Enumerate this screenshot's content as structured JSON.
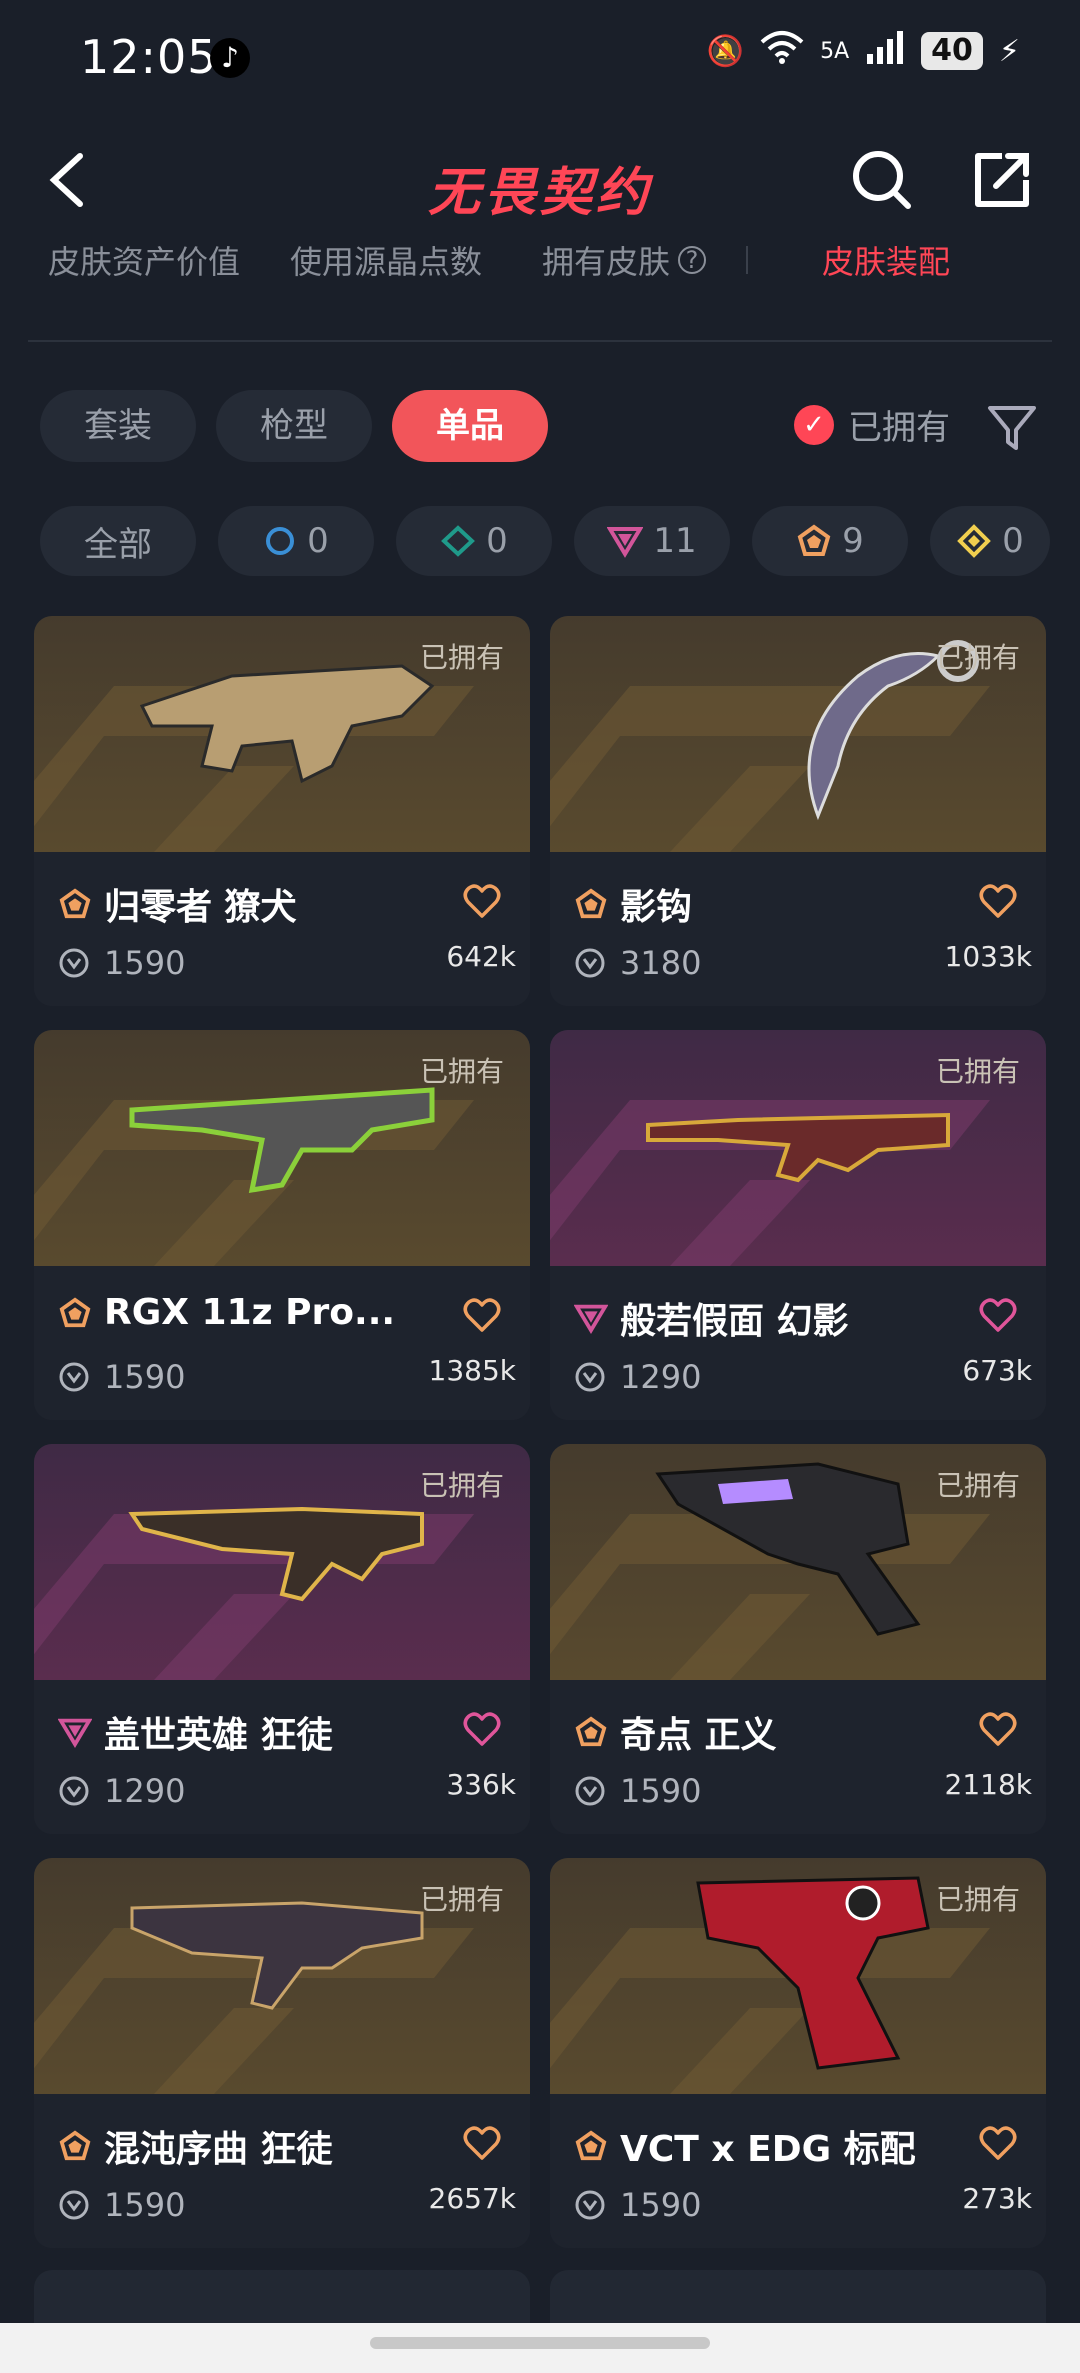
{
  "status": {
    "time": "12:05",
    "network": "5A",
    "battery": "40"
  },
  "header": {
    "title": "无畏契约"
  },
  "subnav": [
    {
      "label": "皮肤资产价值"
    },
    {
      "label": "使用源晶点数"
    },
    {
      "label": "拥有皮肤"
    },
    {
      "label": "皮肤装配",
      "active": true
    }
  ],
  "tabs": [
    {
      "label": "套装"
    },
    {
      "label": "枪型"
    },
    {
      "label": "单品",
      "active": true
    }
  ],
  "owned_filter": {
    "label": "已拥有",
    "checked": true
  },
  "tiers": [
    {
      "label": "全部"
    },
    {
      "icon": "tier-select-icon",
      "count": "0",
      "color": "#3a8fd6"
    },
    {
      "icon": "tier-deluxe-icon",
      "count": "0",
      "color": "#1f9a8a"
    },
    {
      "icon": "tier-premium-icon",
      "count": "11",
      "color": "#d2559a"
    },
    {
      "icon": "tier-exclusive-icon",
      "count": "9",
      "color": "#f0a060"
    },
    {
      "icon": "tier-ultra-icon",
      "count": "0",
      "color": "#f1cf4f"
    }
  ],
  "cards": [
    {
      "name": "归零者 獠犬",
      "price": "1590",
      "likes": "642k",
      "owned": "已拥有",
      "tier": "exclusive",
      "bg": "gold"
    },
    {
      "name": "影钩",
      "price": "3180",
      "likes": "1033k",
      "owned": "已拥有",
      "tier": "exclusive",
      "bg": "gold"
    },
    {
      "name": "RGX 11z Pro...",
      "price": "1590",
      "likes": "1385k",
      "owned": "已拥有",
      "tier": "exclusive",
      "bg": "gold"
    },
    {
      "name": "般若假面 幻影",
      "price": "1290",
      "likes": "673k",
      "owned": "已拥有",
      "tier": "premium",
      "bg": "purple"
    },
    {
      "name": "盖世英雄 狂徒",
      "price": "1290",
      "likes": "336k",
      "owned": "已拥有",
      "tier": "premium",
      "bg": "purple"
    },
    {
      "name": "奇点 正义",
      "price": "1590",
      "likes": "2118k",
      "owned": "已拥有",
      "tier": "exclusive",
      "bg": "gold"
    },
    {
      "name": "混沌序曲 狂徒",
      "price": "1590",
      "likes": "2657k",
      "owned": "已拥有",
      "tier": "exclusive",
      "bg": "gold"
    },
    {
      "name": "VCT x EDG 标配",
      "price": "1590",
      "likes": "273k",
      "owned": "已拥有",
      "tier": "exclusive",
      "bg": "gold"
    }
  ]
}
